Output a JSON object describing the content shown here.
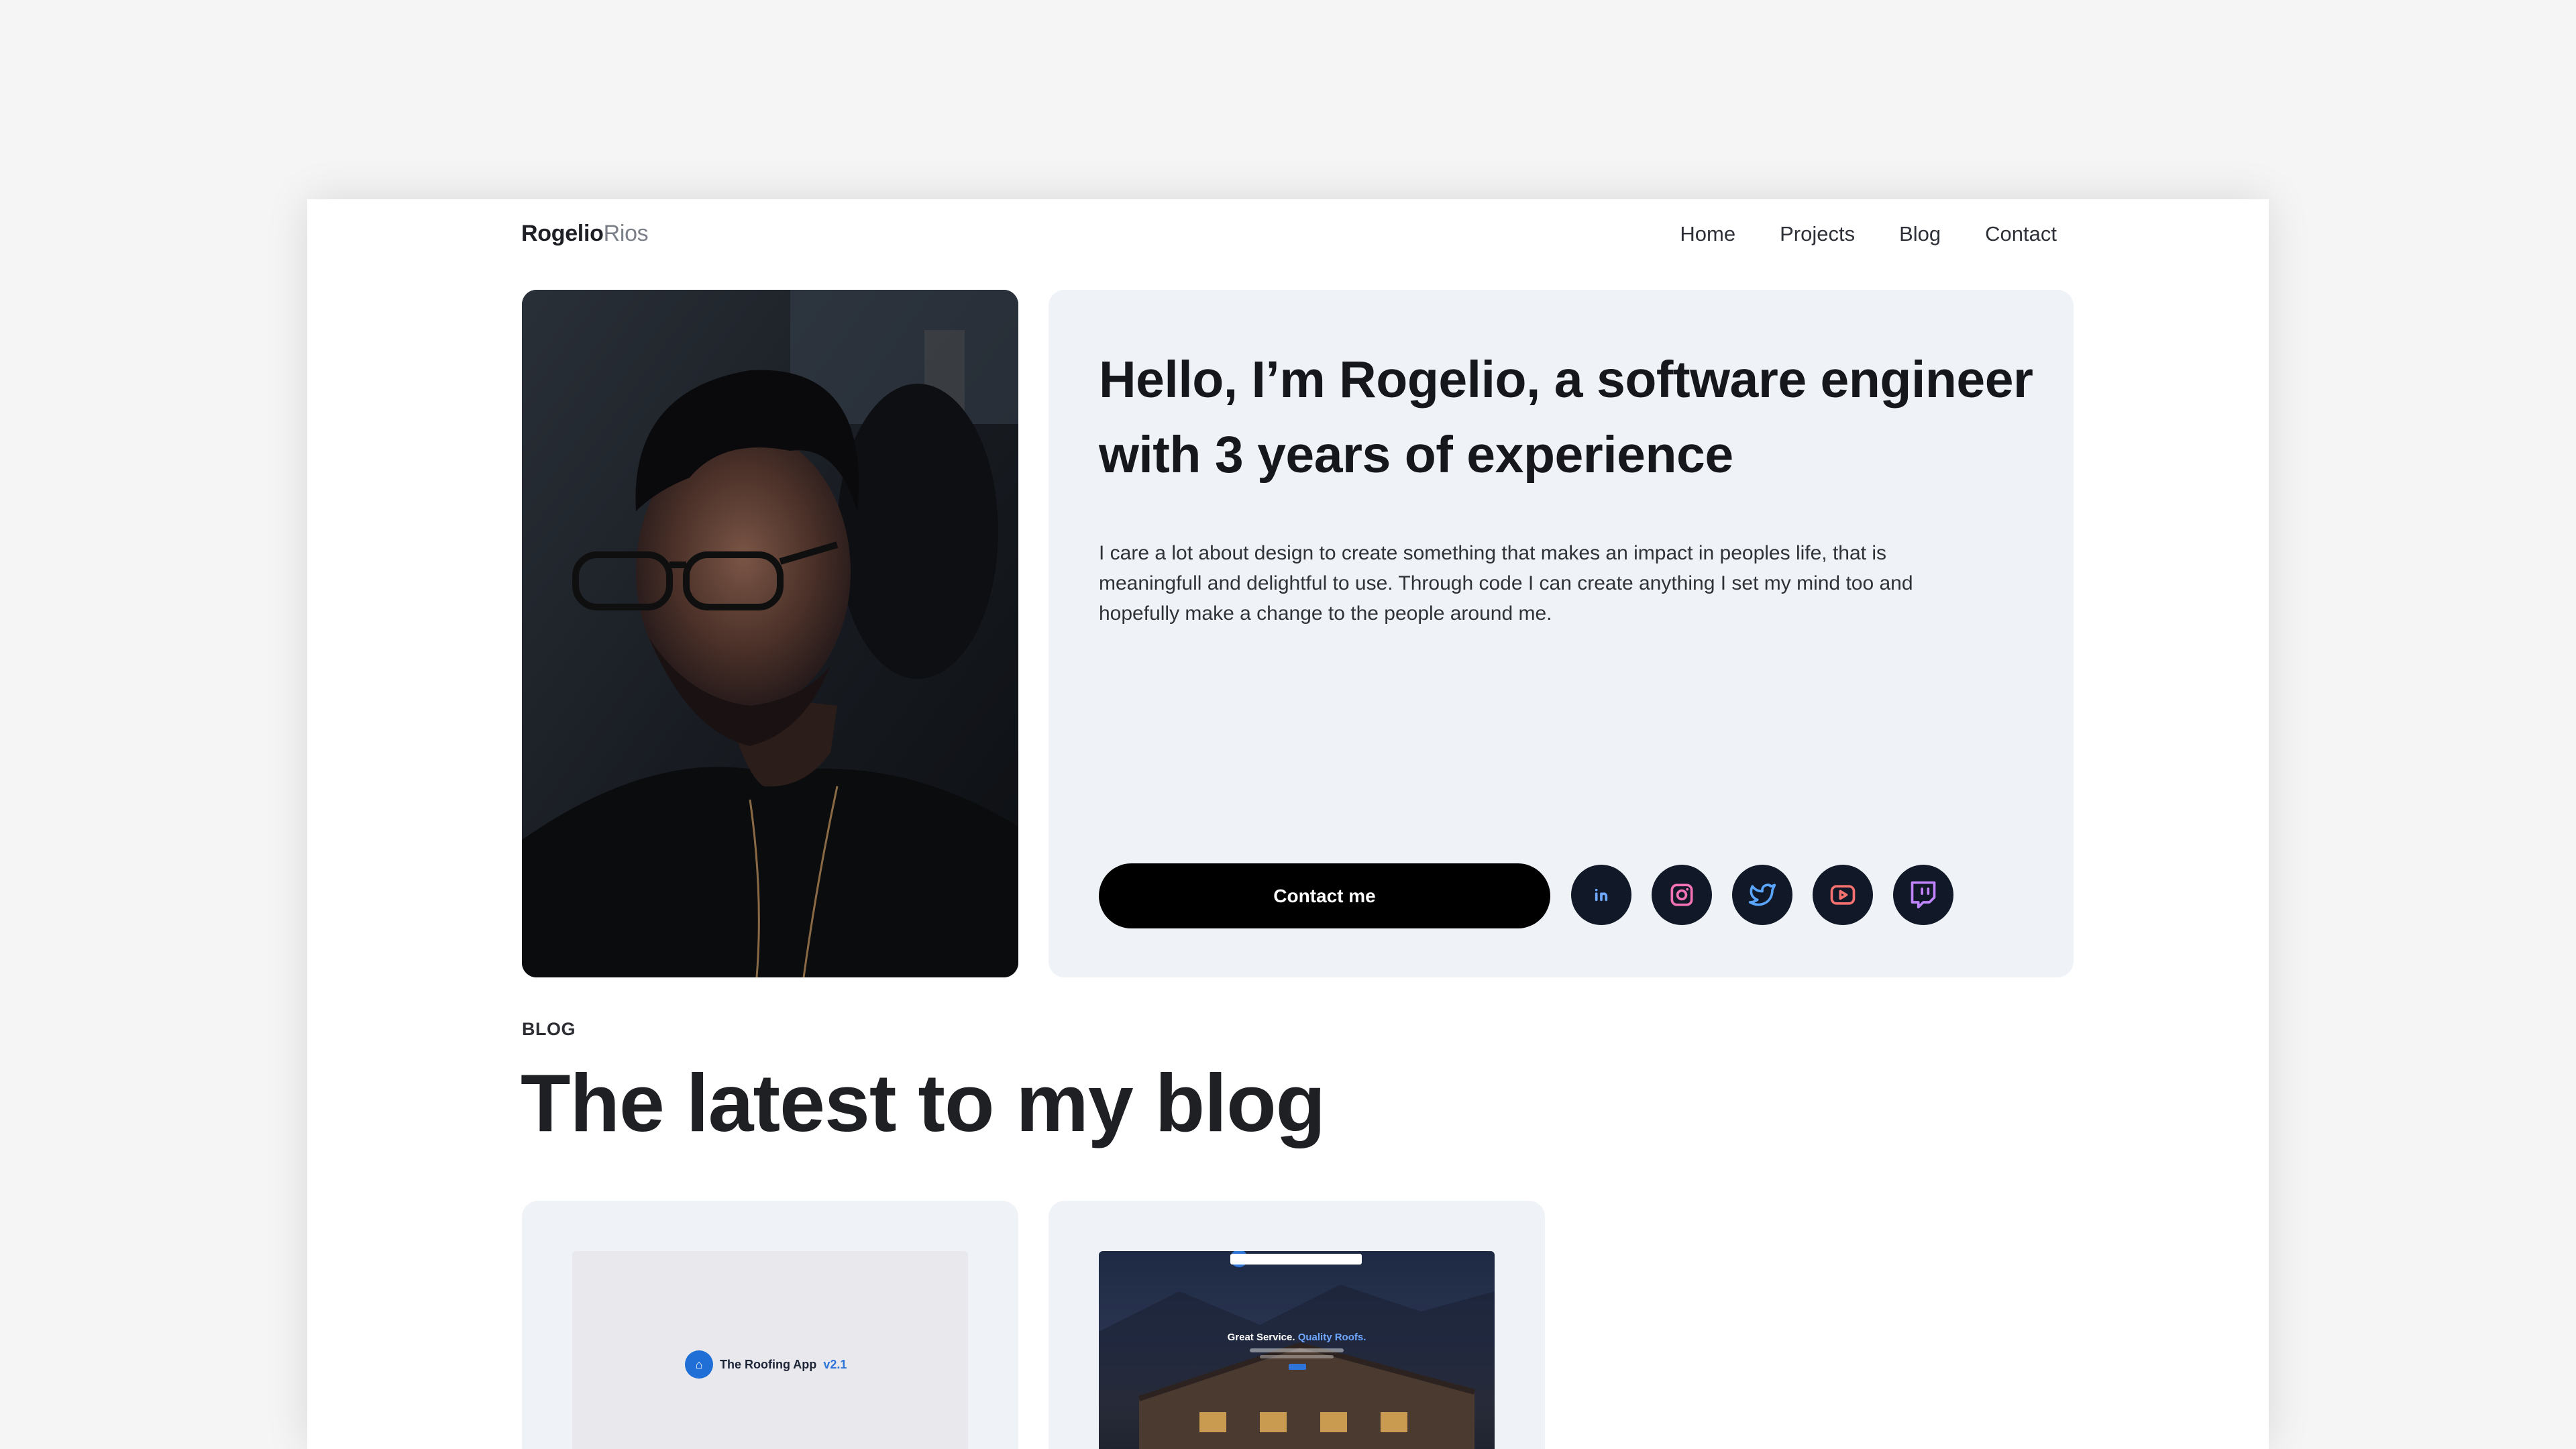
{
  "header": {
    "logo_first": "Rogelio",
    "logo_last": "Rios",
    "nav": [
      "Home",
      "Projects",
      "Blog",
      "Contact"
    ]
  },
  "hero": {
    "title": "Hello, I’m Rogelio, a software engineer with 3 years of experience",
    "text": "I care a lot about design to create something that makes an impact in peoples life, that is meaningfull and delightful to use. Through code I can create anything I set my mind too and hopefully make a change to the people around me.",
    "contact_button": "Contact me",
    "socials": [
      "linkedin-icon",
      "instagram-icon",
      "twitter-icon",
      "youtube-icon",
      "twitch-icon"
    ]
  },
  "blog": {
    "label": "BLOG",
    "title": "The latest to my blog",
    "cards": [
      {
        "thumb_logo": "The Roofing App",
        "thumb_version": "v2.1"
      },
      {
        "thumb_headline_a": "Great Service.",
        "thumb_headline_b": "Quality Roofs."
      }
    ]
  },
  "colors": {
    "accent": "#2f74d8",
    "card_bg": "#eff2f7",
    "button_bg": "#000000",
    "social_bg": "#111827"
  }
}
